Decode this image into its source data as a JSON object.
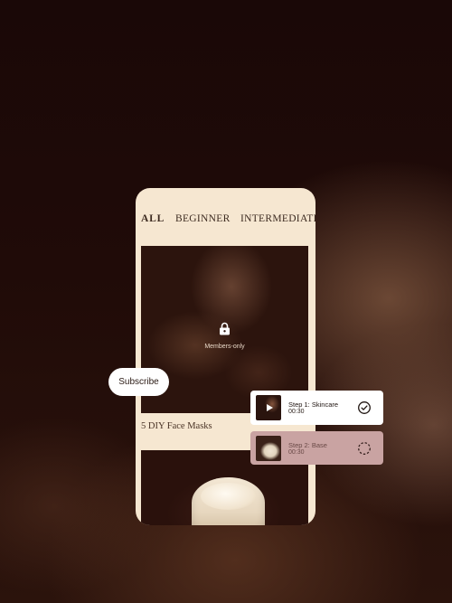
{
  "tabs": {
    "all": "ALL",
    "beginner": "BEGINNER",
    "intermediate": "INTERMEDIATE"
  },
  "hero": {
    "icon": "lock-icon",
    "badge": "Members-only"
  },
  "card": {
    "title": "5 DIY Face Masks"
  },
  "subscribe": {
    "label": "Subscribe"
  },
  "steps": [
    {
      "title": "Step 1: Skincare",
      "time": "00:30",
      "status": "completed",
      "icon": "check-circle-icon"
    },
    {
      "title": "Step 2: Base",
      "time": "00:30",
      "status": "in-progress",
      "icon": "dashed-circle-icon"
    }
  ],
  "colors": {
    "card_background": "#f6e7d1",
    "active_step": "#ffffff",
    "inactive_step": "#c9a3a2",
    "text_dark": "#3c2a20"
  }
}
